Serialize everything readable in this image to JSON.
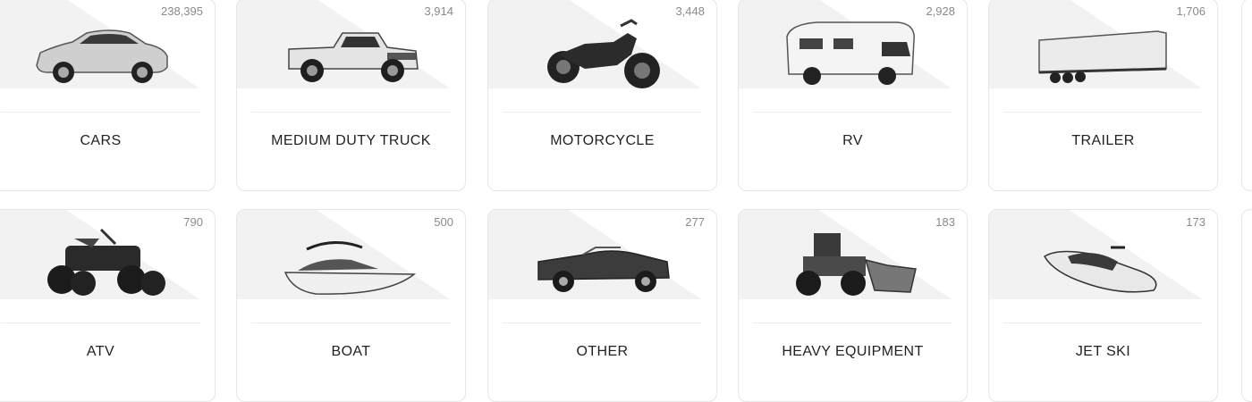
{
  "categories": [
    {
      "label": "CARS",
      "count": "238,395",
      "icon": "car-icon"
    },
    {
      "label": "MEDIUM DUTY TRUCK",
      "count": "3,914",
      "icon": "pickup-truck-icon"
    },
    {
      "label": "MOTORCYCLE",
      "count": "3,448",
      "icon": "motorcycle-icon"
    },
    {
      "label": "RV",
      "count": "2,928",
      "icon": "rv-icon"
    },
    {
      "label": "TRAILER",
      "count": "1,706",
      "icon": "trailer-icon"
    },
    {
      "label": "ATV",
      "count": "790",
      "icon": "atv-icon"
    },
    {
      "label": "BOAT",
      "count": "500",
      "icon": "boat-icon"
    },
    {
      "label": "OTHER",
      "count": "277",
      "icon": "convertible-icon"
    },
    {
      "label": "HEAVY EQUIPMENT",
      "count": "183",
      "icon": "wheel-loader-icon"
    },
    {
      "label": "JET SKI",
      "count": "173",
      "icon": "jet-ski-icon"
    }
  ]
}
